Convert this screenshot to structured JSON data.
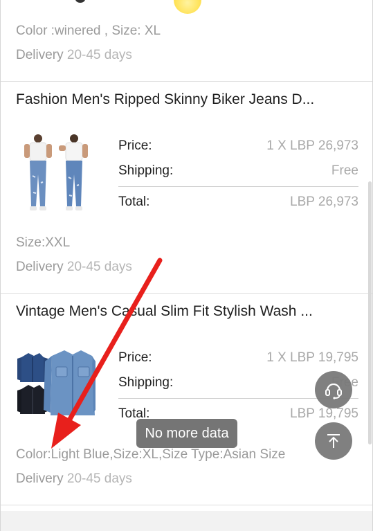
{
  "orders": [
    {
      "spec": "Color :winered , Size: XL",
      "delivery_label": "Delivery",
      "delivery_value": "20-45 days"
    },
    {
      "title": "Fashion Men's Ripped Skinny Biker Jeans D...",
      "thumb_icon": "jeans-product-image",
      "price_label": "Price:",
      "price_value": "1 X LBP 26,973",
      "shipping_label": "Shipping:",
      "shipping_value": "Free",
      "total_label": "Total:",
      "total_value": "LBP 26,973",
      "spec": "Size:XXL",
      "delivery_label": "Delivery",
      "delivery_value": "20-45 days"
    },
    {
      "title": "Vintage Men's Casual Slim Fit Stylish Wash ...",
      "thumb_icon": "denim-shirt-product-image",
      "price_label": "Price:",
      "price_value": "1 X LBP 19,795",
      "shipping_label": "Shipping:",
      "shipping_value": "Free",
      "total_label": "Total:",
      "total_value": "LBP 19,795",
      "spec": "Color:Light Blue,Size:XL,Size Type:Asian Size",
      "delivery_label": "Delivery",
      "delivery_value": "20-45 days"
    }
  ],
  "toast": "No more data",
  "icons": {
    "support": "headset-icon",
    "back_to_top": "arrow-up-to-top-icon"
  },
  "colors": {
    "annotation_arrow": "#e8201c",
    "fab": "#7a7a7a"
  }
}
